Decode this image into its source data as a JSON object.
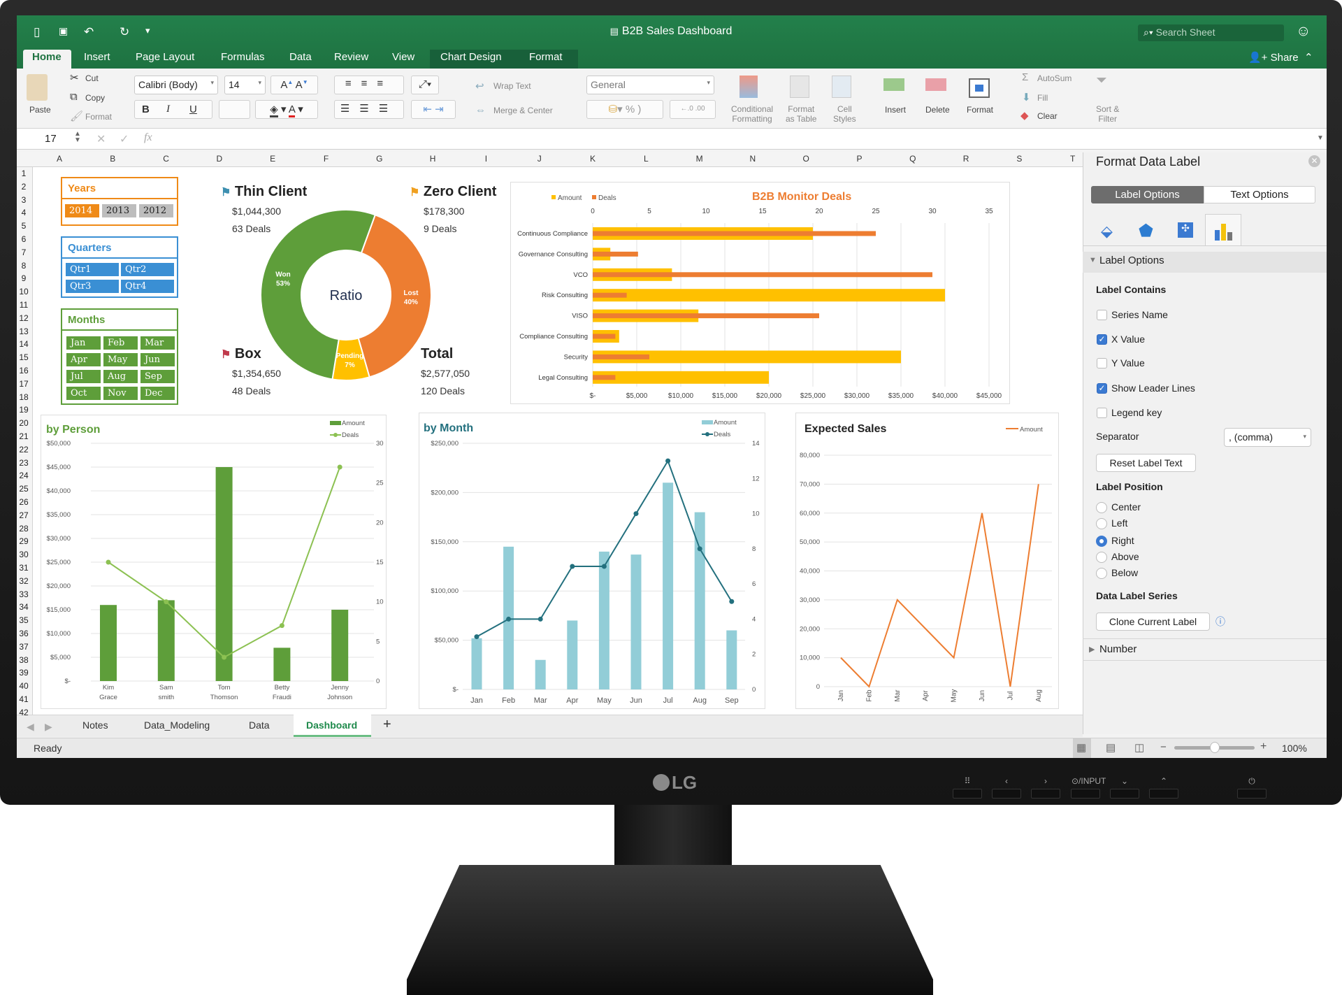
{
  "window": {
    "title": "B2B Sales Dashboard",
    "search_placeholder": "Search Sheet",
    "share": "Share"
  },
  "quick_access": {
    "sidebar": "▯",
    "save": "💾",
    "undo": "↶",
    "redo": "↻",
    "customize": "⩡"
  },
  "ribbon_tabs": [
    "Home",
    "Insert",
    "Page Layout",
    "Formulas",
    "Data",
    "Review",
    "View",
    "Chart Design",
    "Format"
  ],
  "ribbon": {
    "paste": "Paste",
    "cut": "Cut",
    "copy": "Copy",
    "format_painter": "Format",
    "font_name": "Calibri (Body)",
    "font_size": "14",
    "bold": "B",
    "italic": "I",
    "underline": "U",
    "wrap_text": "Wrap Text",
    "merge_center": "Merge & Center",
    "number_format": "General",
    "percent": "%",
    "conditional_formatting": [
      "Conditional",
      "Formatting"
    ],
    "format_as_table": [
      "Format",
      "as Table"
    ],
    "cell_styles": [
      "Cell",
      "Styles"
    ],
    "insert": "Insert",
    "delete": "Delete",
    "format": "Format",
    "autosum": "AutoSum",
    "fill": "Fill",
    "clear": "Clear",
    "sort_filter": [
      "Sort &",
      "Filter"
    ]
  },
  "formula_bar": {
    "cell_ref": "17",
    "fx": "fx",
    "formula": ""
  },
  "columns": [
    "A",
    "B",
    "C",
    "D",
    "E",
    "F",
    "G",
    "H",
    "I",
    "J",
    "K",
    "L",
    "M",
    "N",
    "O",
    "P",
    "Q",
    "R",
    "S",
    "T"
  ],
  "rows": [
    "1",
    "2",
    "3",
    "4",
    "5",
    "6",
    "7",
    "8",
    "9",
    "10",
    "11",
    "12",
    "13",
    "14",
    "15",
    "16",
    "17",
    "18",
    "19",
    "20",
    "21",
    "22",
    "23",
    "24",
    "25",
    "26",
    "27",
    "28",
    "29",
    "30",
    "31",
    "32",
    "33",
    "34",
    "35",
    "36",
    "37",
    "38",
    "39",
    "40",
    "41",
    "42"
  ],
  "slicers": {
    "years": {
      "title": "Years",
      "items": [
        "2014",
        "2013",
        "2012"
      ],
      "selected": "2014",
      "color": "#ef8a17"
    },
    "quarters": {
      "title": "Quarters",
      "items": [
        "Qtr1",
        "Qtr2",
        "Qtr3",
        "Qtr4"
      ],
      "color": "#3a8fd4"
    },
    "months": {
      "title": "Months",
      "items": [
        "Jan",
        "Feb",
        "Mar",
        "Apr",
        "May",
        "Jun",
        "Jul",
        "Aug",
        "Sep",
        "Oct",
        "Nov",
        "Dec"
      ],
      "color": "#5e9e3a"
    }
  },
  "kpis": [
    {
      "title": "Thin Client",
      "amount": "$1,044,300",
      "deals": "63 Deals",
      "flag_color": "#3d8fb0"
    },
    {
      "title": "Zero Client",
      "amount": "$178,300",
      "deals": "9 Deals",
      "flag_color": "#f0a020"
    },
    {
      "title": "Box",
      "amount": "$1,354,650",
      "deals": "48 Deals",
      "flag_color": "#c0394b"
    },
    {
      "title": "Total",
      "amount": "$2,577,050",
      "deals": "120 Deals"
    }
  ],
  "chart_data": [
    {
      "type": "pie",
      "variant": "donut",
      "center_label": "Ratio",
      "slices": [
        {
          "label": "Lost",
          "value": 40,
          "text": "40%",
          "color": "#ed7d31"
        },
        {
          "label": "Pending",
          "value": 7,
          "text": "7%",
          "color": "#ffc000"
        },
        {
          "label": "Won",
          "value": 53,
          "text": "53%",
          "color": "#5e9e3a"
        }
      ]
    },
    {
      "type": "bar",
      "orientation": "horizontal",
      "title": "B2B Monitor Deals",
      "legend": "top-left",
      "categories": [
        "Continuous Compliance",
        "Governance Consulting",
        "VCO",
        "Risk Consulting",
        "VISO",
        "Compliance Consulting",
        "Security",
        "Legal Consulting"
      ],
      "series": [
        {
          "name": "Amount",
          "values": [
            25000,
            2000,
            9000,
            40000,
            12000,
            3000,
            35000,
            20000
          ],
          "color": "#ffc000",
          "axis": "bottom"
        },
        {
          "name": "Deals",
          "values": [
            25,
            4,
            30,
            3,
            20,
            2,
            5,
            2
          ],
          "color": "#ed7d31",
          "axis": "top"
        }
      ],
      "xlim": [
        0,
        45000
      ],
      "x_tick_labels": [
        "$-",
        "$5,000",
        "$10,000",
        "$15,000",
        "$20,000",
        "$25,000",
        "$30,000",
        "$35,000",
        "$40,000",
        "$45,000"
      ],
      "x2lim": [
        0,
        35
      ],
      "x2_tick_labels": [
        "0",
        "5",
        "10",
        "15",
        "20",
        "25",
        "30",
        "35"
      ],
      "grid": true
    },
    {
      "type": "bar",
      "title": "by Person",
      "legend": "top-right",
      "categories": [
        [
          "Kim",
          "Grace"
        ],
        [
          "Sam",
          "smith"
        ],
        [
          "Tom",
          "Thomson"
        ],
        [
          "Betty",
          "Fraudi"
        ],
        [
          "Jenny",
          "Johnson"
        ]
      ],
      "series": [
        {
          "name": "Amount",
          "type": "bar",
          "values": [
            16000,
            17000,
            45000,
            7000,
            15000
          ],
          "color": "#5e9e3a"
        },
        {
          "name": "Deals",
          "type": "line",
          "values": [
            15,
            10,
            3,
            7,
            27
          ],
          "color": "#8cc152",
          "axis": "right"
        }
      ],
      "ylim": [
        0,
        50000
      ],
      "y_tick_labels": [
        "$-",
        "$5,000",
        "$10,000",
        "$15,000",
        "$20,000",
        "$25,000",
        "$30,000",
        "$35,000",
        "$40,000",
        "$45,000",
        "$50,000"
      ],
      "y2lim": [
        0,
        30
      ],
      "y2_tick_labels": [
        "0",
        "5",
        "10",
        "15",
        "20",
        "25",
        "30"
      ],
      "grid": true
    },
    {
      "type": "bar",
      "title": "by Month",
      "legend": "top-right",
      "categories": [
        "Jan",
        "Feb",
        "Mar",
        "Apr",
        "May",
        "Jun",
        "Jul",
        "Aug",
        "Sep"
      ],
      "series": [
        {
          "name": "Amount",
          "type": "bar",
          "values": [
            52000,
            145000,
            30000,
            70000,
            140000,
            137000,
            210000,
            180000,
            60000
          ],
          "color": "#92cdd7"
        },
        {
          "name": "Deals",
          "type": "line",
          "values": [
            3,
            4,
            4,
            7,
            7,
            10,
            13,
            8,
            5
          ],
          "color": "#23707e",
          "axis": "right"
        }
      ],
      "ylim": [
        0,
        250000
      ],
      "y_tick_labels": [
        "$-",
        "$50,000",
        "$100,000",
        "$150,000",
        "$200,000",
        "$250,000"
      ],
      "y2lim": [
        0,
        14
      ],
      "y2_tick_labels": [
        "0",
        "2",
        "4",
        "6",
        "8",
        "10",
        "12",
        "14"
      ],
      "grid": true
    },
    {
      "type": "line",
      "title": "Expected Sales",
      "legend": "top-right",
      "categories": [
        "Jan",
        "Feb",
        "Mar",
        "Apr",
        "May",
        "Jun",
        "Jul",
        "Aug"
      ],
      "series": [
        {
          "name": "Amount",
          "values": [
            10000,
            0,
            30000,
            20000,
            10000,
            60000,
            0,
            70000
          ],
          "color": "#ed7d31"
        }
      ],
      "ylim": [
        0,
        80000
      ],
      "y_tick_labels": [
        "0",
        "10,000",
        "20,000",
        "30,000",
        "40,000",
        "50,000",
        "60,000",
        "70,000",
        "80,000"
      ],
      "grid": true
    }
  ],
  "task_pane": {
    "title": "Format Data Label",
    "tabs": [
      "Label Options",
      "Text Options"
    ],
    "active_tab": "Label Options",
    "section": "Label Options",
    "label_contains": "Label Contains",
    "checkboxes": [
      {
        "label": "Series Name",
        "checked": false
      },
      {
        "label": "X Value",
        "checked": true
      },
      {
        "label": "Y Value",
        "checked": false
      },
      {
        "label": "Show Leader Lines",
        "checked": true
      },
      {
        "label": "Legend key",
        "checked": false
      }
    ],
    "separator_label": "Separator",
    "separator_value": ", (comma)",
    "reset_button": "Reset Label Text",
    "label_position": "Label Position",
    "positions": [
      "Center",
      "Left",
      "Right",
      "Above",
      "Below"
    ],
    "selected_position": "Right",
    "data_label_series": "Data Label Series",
    "clone_button": "Clone Current Label",
    "number_section": "Number"
  },
  "sheet_tabs": [
    "Notes",
    "Data_Modeling",
    "Data",
    "Dashboard"
  ],
  "active_sheet": "Dashboard",
  "add_sheet": "+",
  "status": {
    "text": "Ready",
    "zoom": "100%",
    "zoom_level": 100
  },
  "monitor": {
    "brand": "LG",
    "buttons": [
      "⠿",
      "‹",
      "›",
      "⊙/INPUT",
      "⌄",
      "⌃",
      "⏻"
    ]
  }
}
